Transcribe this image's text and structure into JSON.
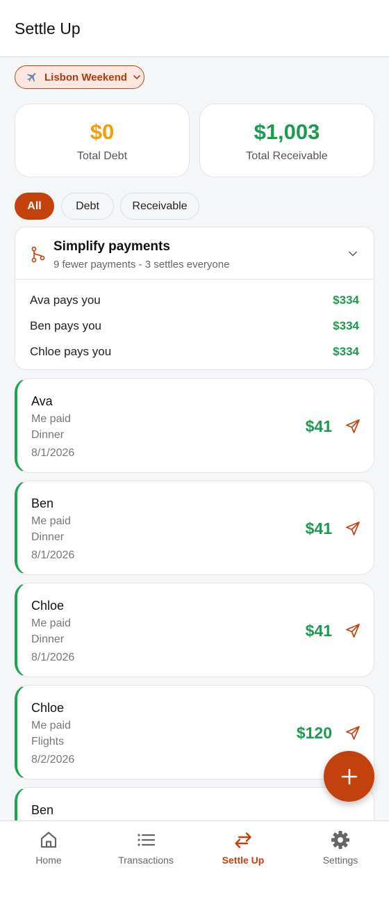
{
  "header": {
    "title": "Settle Up"
  },
  "trip_selector": {
    "label": "Lisbon Weekend",
    "icon": "plane-icon"
  },
  "summary": {
    "debt": {
      "value": "$0",
      "label": "Total Debt",
      "color": "#f59e0b"
    },
    "receivable": {
      "value": "$1,003",
      "label": "Total Receivable",
      "color": "#1a9b4e"
    }
  },
  "filters": [
    {
      "label": "All",
      "active": true
    },
    {
      "label": "Debt",
      "active": false
    },
    {
      "label": "Receivable",
      "active": false
    }
  ],
  "simplify": {
    "title": "Simplify payments",
    "subtitle": "9 fewer payments - 3 settles everyone",
    "rows": [
      {
        "who": "Ava pays you",
        "amount": "$334"
      },
      {
        "who": "Ben pays you",
        "amount": "$334"
      },
      {
        "who": "Chloe pays you",
        "amount": "$334"
      }
    ]
  },
  "payments": [
    {
      "name": "Ava",
      "payer": "Me paid",
      "item": "Dinner",
      "date": "8/1/2026",
      "amount": "$41"
    },
    {
      "name": "Ben",
      "payer": "Me paid",
      "item": "Dinner",
      "date": "8/1/2026",
      "amount": "$41"
    },
    {
      "name": "Chloe",
      "payer": "Me paid",
      "item": "Dinner",
      "date": "8/1/2026",
      "amount": "$41"
    },
    {
      "name": "Chloe",
      "payer": "Me paid",
      "item": "Flights",
      "date": "8/2/2026",
      "amount": "$120"
    },
    {
      "name": "Ben",
      "payer": "",
      "item": "",
      "date": "",
      "amount": ""
    }
  ],
  "nav": [
    {
      "label": "Home",
      "icon": "home-icon",
      "active": false
    },
    {
      "label": "Transactions",
      "icon": "list-icon",
      "active": false
    },
    {
      "label": "Settle Up",
      "icon": "swap-arrows-icon",
      "active": true
    },
    {
      "label": "Settings",
      "icon": "gear-icon",
      "active": false
    }
  ],
  "colors": {
    "accent": "#c2410c",
    "positive": "#1a9b4e",
    "debt": "#f59e0b"
  }
}
